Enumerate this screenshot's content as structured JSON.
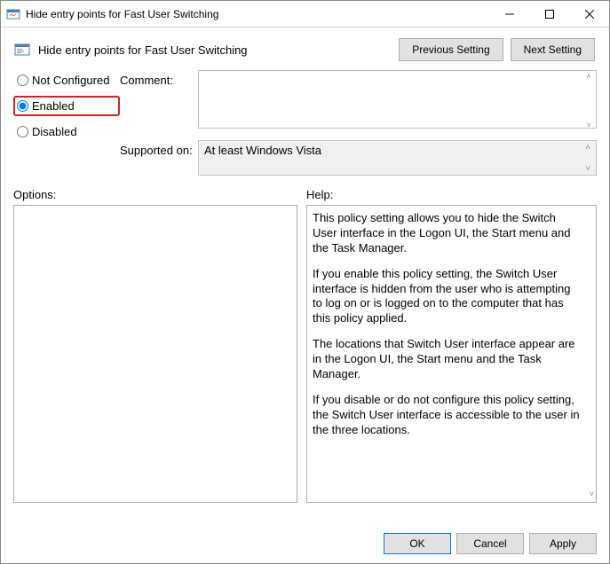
{
  "window": {
    "title": "Hide entry points for Fast User Switching"
  },
  "header": {
    "title": "Hide entry points for Fast User Switching",
    "prev_button": "Previous Setting",
    "next_button": "Next Setting"
  },
  "policy": {
    "not_configured_label": "Not Configured",
    "enabled_label": "Enabled",
    "disabled_label": "Disabled",
    "selected": "enabled"
  },
  "form": {
    "comment_label": "Comment:",
    "comment_value": "",
    "supported_label": "Supported on:",
    "supported_value": "At least Windows Vista"
  },
  "lower": {
    "options_label": "Options:",
    "help_label": "Help:"
  },
  "help": {
    "p1": "This policy setting allows you to hide the Switch User interface in the Logon UI, the Start menu and the Task Manager.",
    "p2": "If you enable this policy setting, the Switch User interface is hidden from the user who is attempting to log on or is logged on to the computer that has this policy applied.",
    "p3": "The locations that Switch User interface appear are in the Logon UI, the Start menu and the Task Manager.",
    "p4": "If you disable or do not configure this policy setting, the Switch User interface is accessible to the user in the three locations."
  },
  "footer": {
    "ok": "OK",
    "cancel": "Cancel",
    "apply": "Apply"
  }
}
